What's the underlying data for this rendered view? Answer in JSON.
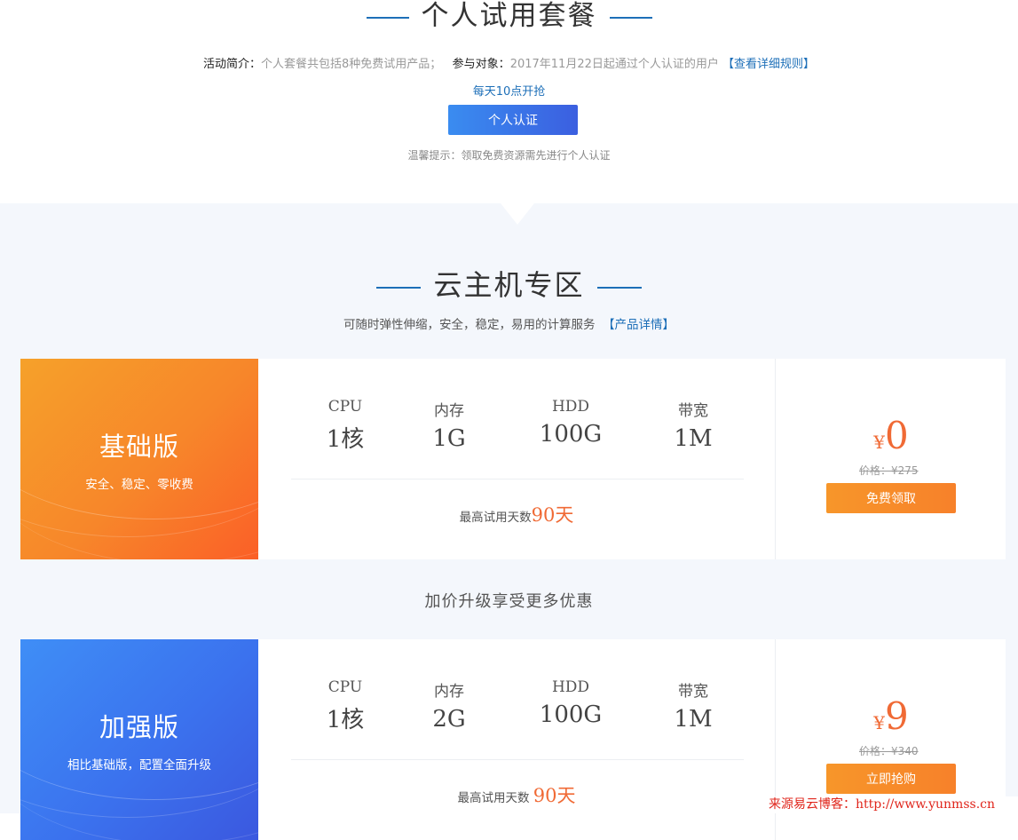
{
  "personal_section": {
    "title": "个人试用套餐",
    "intro_label": "活动简介：",
    "intro_text": "个人套餐共包括8种免费试用产品；",
    "target_label": "参与对象：",
    "target_text": "2017年11月22日起通过个人认证的用户",
    "rules_link": "【查看详细规则】",
    "daily_notice": "每天10点开抢",
    "auth_button": "个人认证",
    "tip": "温馨提示：领取免费资源需先进行个人认证"
  },
  "cloud_section": {
    "title": "云主机专区",
    "subtitle": "可随时弹性伸缩，安全，稳定，易用的计算服务",
    "detail_link": "【产品详情】",
    "upgrade_text": "加价升级享受更多优惠"
  },
  "plans": [
    {
      "name": "基础版",
      "desc": "安全、稳定、零收费",
      "color": "#f7862a",
      "specs": [
        {
          "label": "CPU",
          "value": "1核"
        },
        {
          "label": "内存",
          "value": "1G"
        },
        {
          "label": "HDD",
          "value": "100G"
        },
        {
          "label": "带宽",
          "value": "1M"
        }
      ],
      "days_label": "最高试用天数",
      "days_value": "90天",
      "currency": "¥",
      "price": "0",
      "original_price": "价格：¥275",
      "button": "免费领取"
    },
    {
      "name": "加强版",
      "desc": "相比基础版，配置全面升级",
      "color": "#3b72ee",
      "specs": [
        {
          "label": "CPU",
          "value": "1核"
        },
        {
          "label": "内存",
          "value": "2G"
        },
        {
          "label": "HDD",
          "value": "100G"
        },
        {
          "label": "带宽",
          "value": "1M"
        }
      ],
      "days_label": "最高试用天数",
      "days_value": "90天",
      "currency": "¥",
      "price": "9",
      "original_price": "价格：¥340",
      "button": "立即抢购"
    }
  ],
  "watermark": "来源易云博客：http://www.yunmss.cn",
  "colors": {
    "link": "#1d6fb8",
    "price": "#f06a35",
    "button_orange": "#f7862a",
    "button_blue": "#3b6fe8",
    "section_bg": "#f4f7fc"
  }
}
